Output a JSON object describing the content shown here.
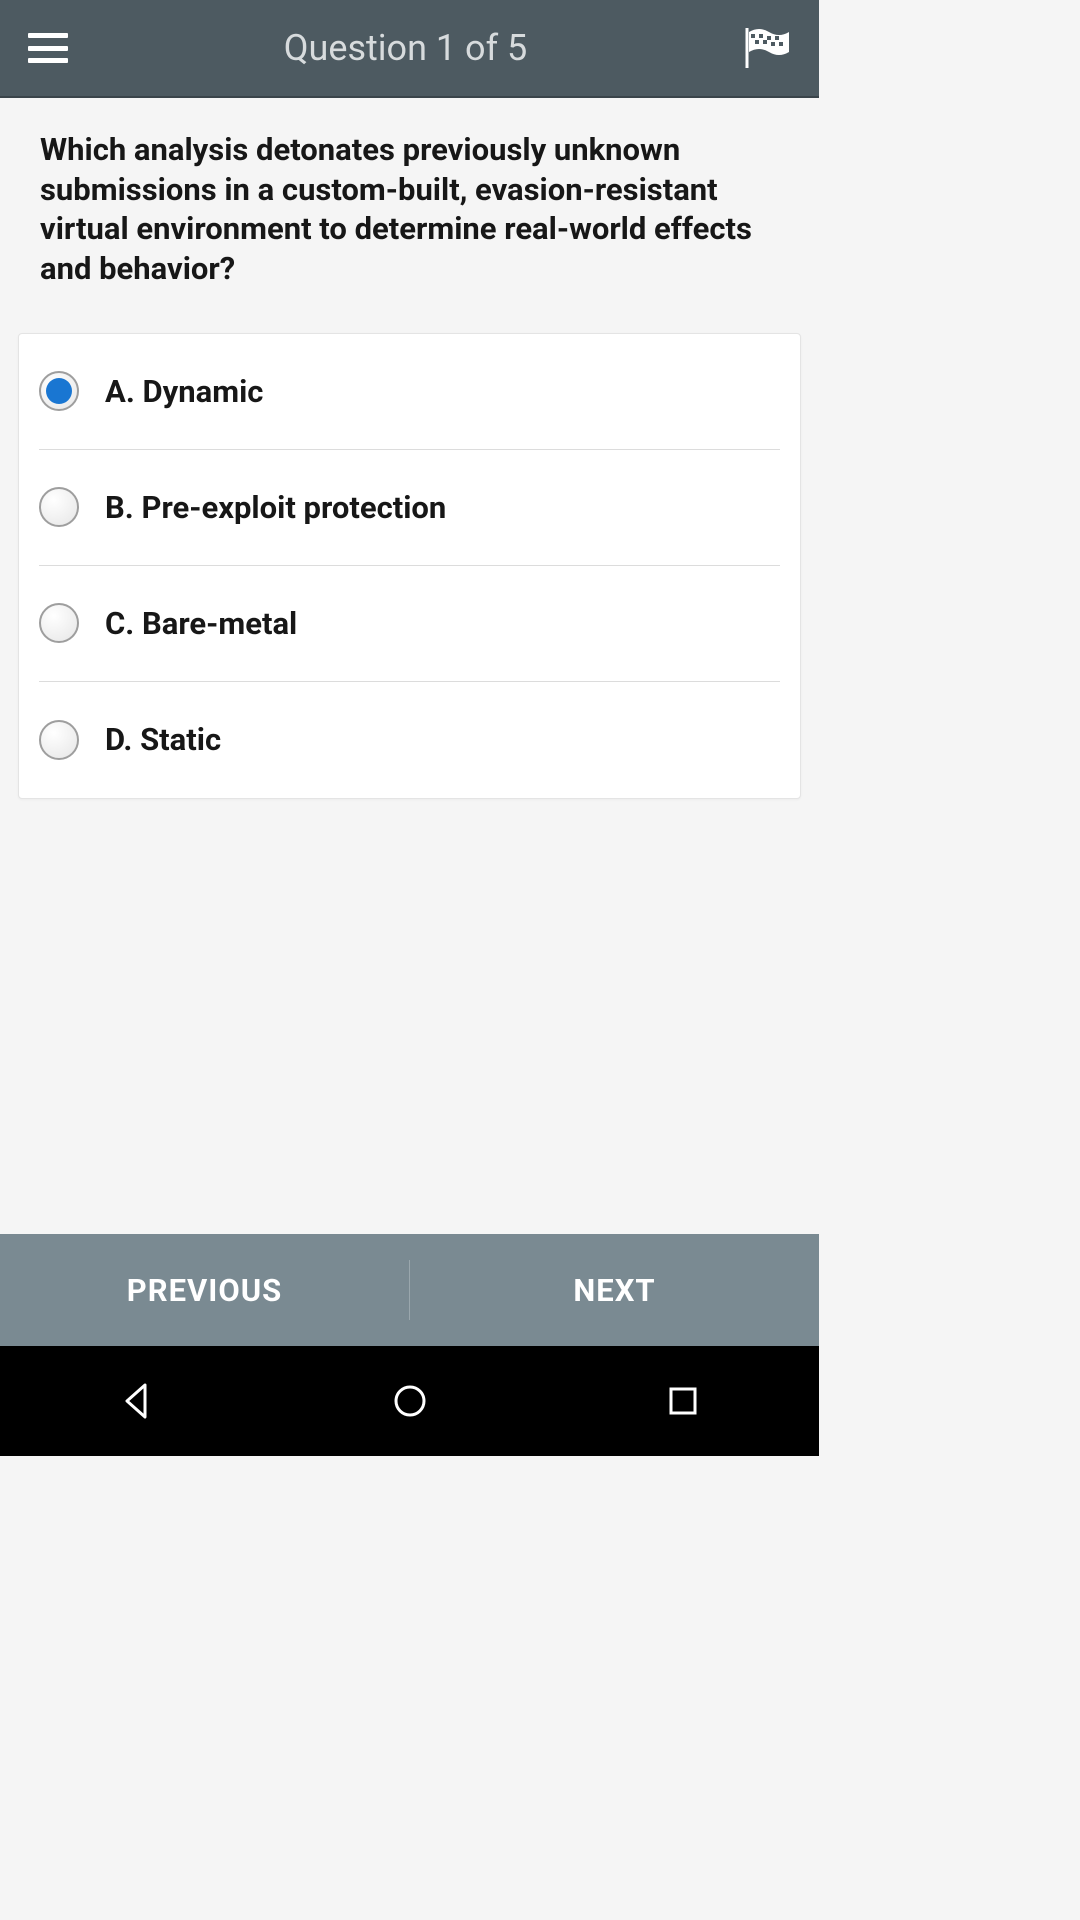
{
  "header": {
    "title": "Question 1 of 5"
  },
  "question": {
    "text": "Which analysis detonates previously unknown submissions in a custom-built, evasion-resistant virtual environment to determine real-world effects and behavior?"
  },
  "answers": [
    {
      "label": "A. Dynamic",
      "selected": true
    },
    {
      "label": "B. Pre-exploit protection",
      "selected": false
    },
    {
      "label": "C. Bare-metal",
      "selected": false
    },
    {
      "label": "D. Static",
      "selected": false
    }
  ],
  "nav": {
    "previous": "PREVIOUS",
    "next": "NEXT"
  },
  "colors": {
    "header_bg": "#4d5a61",
    "accent": "#1976d2",
    "bottom_nav_bg": "#7a8a92"
  }
}
